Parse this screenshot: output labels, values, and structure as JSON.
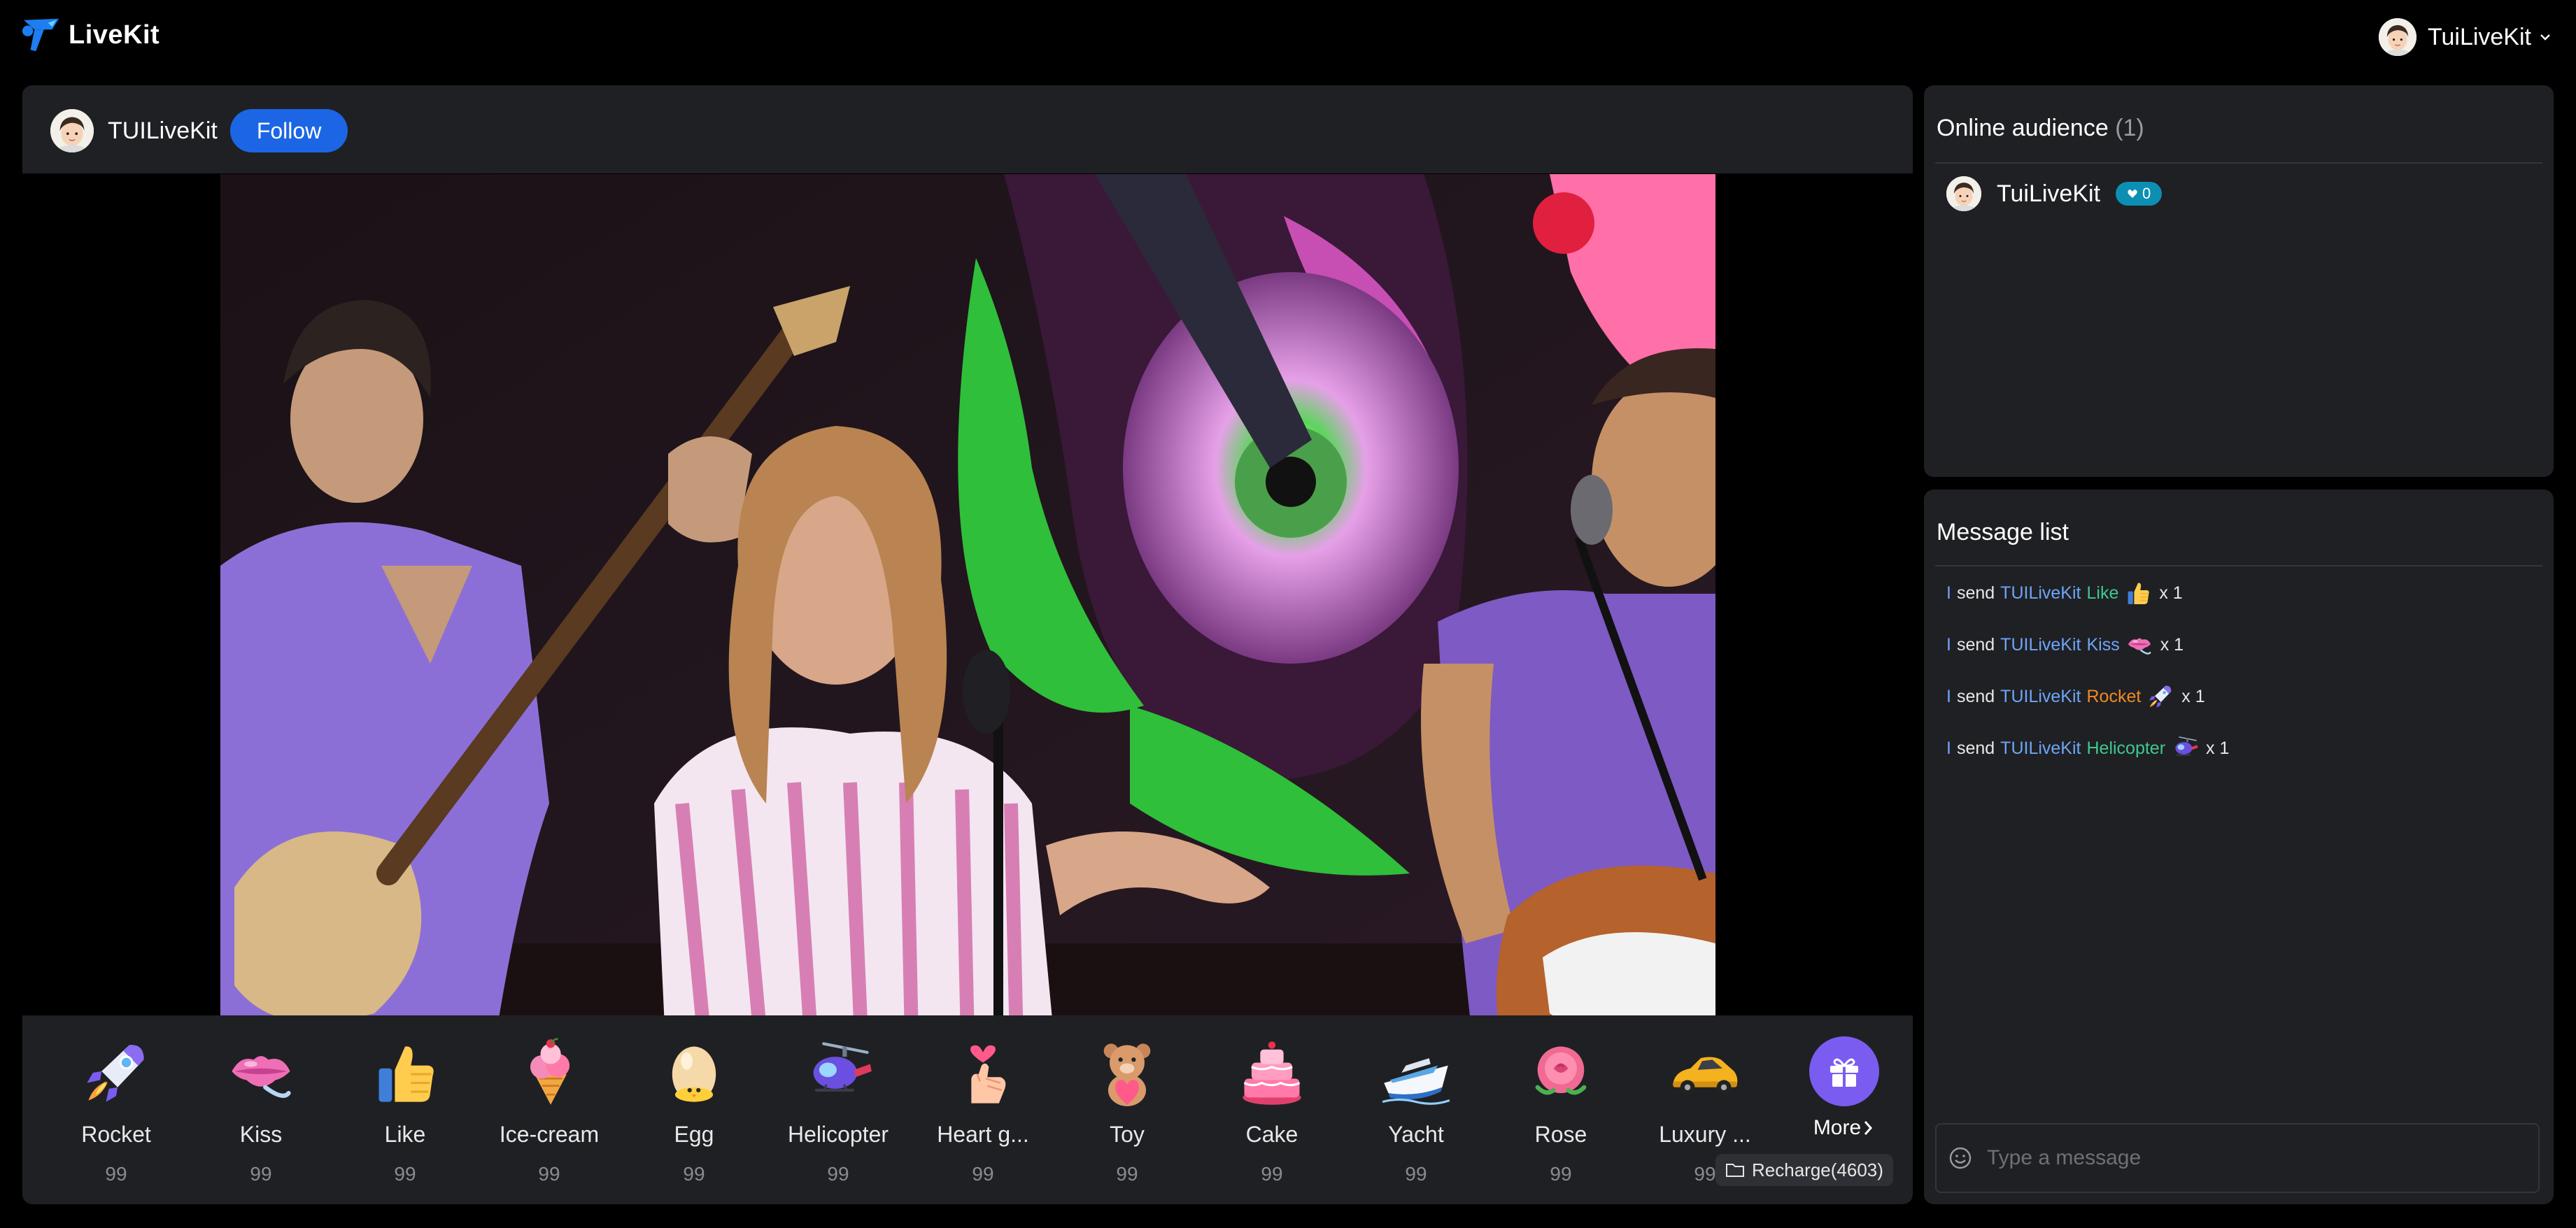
{
  "app": {
    "brand": "LiveKit"
  },
  "user_menu": {
    "name": "TuiLiveKit"
  },
  "anchor": {
    "name": "TUILiveKit",
    "follow_label": "Follow"
  },
  "gifts": [
    {
      "name": "Rocket",
      "price": "99",
      "icon": "rocket-icon"
    },
    {
      "name": "Kiss",
      "price": "99",
      "icon": "kiss-lips-icon"
    },
    {
      "name": "Like",
      "price": "99",
      "icon": "thumbs-up-icon"
    },
    {
      "name": "Ice-cream",
      "price": "99",
      "icon": "ice-cream-icon"
    },
    {
      "name": "Egg",
      "price": "99",
      "icon": "egg-icon"
    },
    {
      "name": "Helicopter",
      "price": "99",
      "icon": "helicopter-icon"
    },
    {
      "name": "Heart g...",
      "price": "99",
      "icon": "heart-gesture-icon"
    },
    {
      "name": "Toy",
      "price": "99",
      "icon": "teddy-bear-icon"
    },
    {
      "name": "Cake",
      "price": "99",
      "icon": "cake-icon"
    },
    {
      "name": "Yacht",
      "price": "99",
      "icon": "yacht-icon"
    },
    {
      "name": "Rose",
      "price": "99",
      "icon": "rose-icon"
    },
    {
      "name": "Luxury ...",
      "price": "99",
      "icon": "sports-car-icon"
    }
  ],
  "more": {
    "label": "More"
  },
  "recharge": {
    "label": "Recharge(4603)"
  },
  "audience": {
    "title": "Online audience",
    "count": "(1)",
    "members": [
      {
        "name": "TuiLiveKit",
        "badge": "0"
      }
    ]
  },
  "messages": {
    "title": "Message list",
    "items": [
      {
        "sender": "I",
        "verb": "send",
        "target": "TUILiveKit",
        "gift": "Like",
        "gift_color": "#3ec98e",
        "icon": "thumbs-up-icon",
        "qty": "x 1"
      },
      {
        "sender": "I",
        "verb": "send",
        "target": "TUILiveKit",
        "gift": "Kiss",
        "gift_color": "#6ea5f6",
        "icon": "kiss-lips-icon",
        "qty": "x 1"
      },
      {
        "sender": "I",
        "verb": "send",
        "target": "TUILiveKit",
        "gift": "Rocket",
        "gift_color": "#f08a24",
        "icon": "rocket-icon",
        "qty": "x 1"
      },
      {
        "sender": "I",
        "verb": "send",
        "target": "TUILiveKit",
        "gift": "Helicopter",
        "gift_color": "#3ec98e",
        "icon": "helicopter-icon",
        "qty": "x 1"
      }
    ],
    "input_placeholder": "Type a message"
  },
  "colors": {
    "accent": "#1c66e5",
    "panel": "#1f2024",
    "more_button": "#7b5cf0",
    "badge": "#0c8fb3"
  }
}
